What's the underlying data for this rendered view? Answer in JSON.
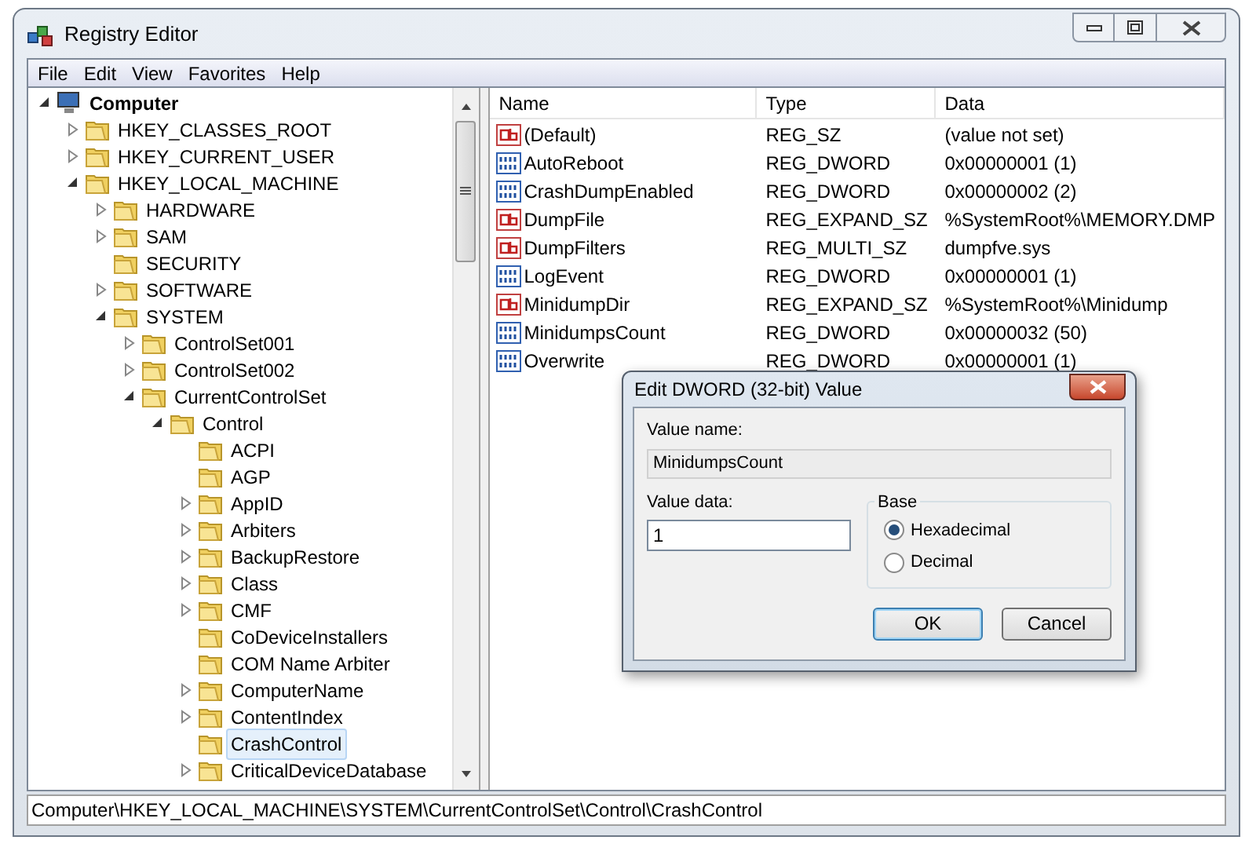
{
  "window": {
    "title": "Registry Editor"
  },
  "menu": [
    "File",
    "Edit",
    "View",
    "Favorites",
    "Help"
  ],
  "tree": [
    {
      "label": "Computer",
      "kind": "computer",
      "expanded": true,
      "selected": false,
      "children": [
        {
          "label": "HKEY_CLASSES_ROOT",
          "kind": "branch",
          "expanded": false,
          "selected": false
        },
        {
          "label": "HKEY_CURRENT_USER",
          "kind": "branch",
          "expanded": false,
          "selected": false
        },
        {
          "label": "HKEY_LOCAL_MACHINE",
          "kind": "branch",
          "expanded": true,
          "selected": false,
          "children": [
            {
              "label": "HARDWARE",
              "kind": "branch",
              "expanded": false,
              "selected": false
            },
            {
              "label": "SAM",
              "kind": "branch",
              "expanded": false,
              "selected": false
            },
            {
              "label": "SECURITY",
              "kind": "leaf",
              "selected": false
            },
            {
              "label": "SOFTWARE",
              "kind": "branch",
              "expanded": false,
              "selected": false
            },
            {
              "label": "SYSTEM",
              "kind": "branch",
              "expanded": true,
              "selected": false,
              "children": [
                {
                  "label": "ControlSet001",
                  "kind": "branch",
                  "expanded": false,
                  "selected": false
                },
                {
                  "label": "ControlSet002",
                  "kind": "branch",
                  "expanded": false,
                  "selected": false
                },
                {
                  "label": "CurrentControlSet",
                  "kind": "branch",
                  "expanded": true,
                  "selected": false,
                  "children": [
                    {
                      "label": "Control",
                      "kind": "branch",
                      "expanded": true,
                      "selected": false,
                      "children": [
                        {
                          "label": "ACPI",
                          "kind": "leaf",
                          "selected": false
                        },
                        {
                          "label": "AGP",
                          "kind": "leaf",
                          "selected": false
                        },
                        {
                          "label": "AppID",
                          "kind": "branch",
                          "expanded": false,
                          "selected": false
                        },
                        {
                          "label": "Arbiters",
                          "kind": "branch",
                          "expanded": false,
                          "selected": false
                        },
                        {
                          "label": "BackupRestore",
                          "kind": "branch",
                          "expanded": false,
                          "selected": false
                        },
                        {
                          "label": "Class",
                          "kind": "branch",
                          "expanded": false,
                          "selected": false
                        },
                        {
                          "label": "CMF",
                          "kind": "branch",
                          "expanded": false,
                          "selected": false
                        },
                        {
                          "label": "CoDeviceInstallers",
                          "kind": "leaf",
                          "selected": false
                        },
                        {
                          "label": "COM Name Arbiter",
                          "kind": "leaf",
                          "selected": false
                        },
                        {
                          "label": "ComputerName",
                          "kind": "branch",
                          "expanded": false,
                          "selected": false
                        },
                        {
                          "label": "ContentIndex",
                          "kind": "branch",
                          "expanded": false,
                          "selected": false
                        },
                        {
                          "label": "CrashControl",
                          "kind": "leaf",
                          "selected": true
                        },
                        {
                          "label": "CriticalDeviceDatabase",
                          "kind": "branch",
                          "expanded": false,
                          "selected": false
                        }
                      ]
                    }
                  ]
                }
              ]
            }
          ]
        }
      ]
    }
  ],
  "values": {
    "columns": [
      "Name",
      "Type",
      "Data"
    ],
    "rows": [
      {
        "kind": "string",
        "name": "(Default)",
        "type": "REG_SZ",
        "data": "(value not set)"
      },
      {
        "kind": "binary",
        "name": "AutoReboot",
        "type": "REG_DWORD",
        "data": "0x00000001 (1)"
      },
      {
        "kind": "binary",
        "name": "CrashDumpEnabled",
        "type": "REG_DWORD",
        "data": "0x00000002 (2)"
      },
      {
        "kind": "string",
        "name": "DumpFile",
        "type": "REG_EXPAND_SZ",
        "data": "%SystemRoot%\\MEMORY.DMP"
      },
      {
        "kind": "string",
        "name": "DumpFilters",
        "type": "REG_MULTI_SZ",
        "data": "dumpfve.sys"
      },
      {
        "kind": "binary",
        "name": "LogEvent",
        "type": "REG_DWORD",
        "data": "0x00000001 (1)"
      },
      {
        "kind": "string",
        "name": "MinidumpDir",
        "type": "REG_EXPAND_SZ",
        "data": "%SystemRoot%\\Minidump"
      },
      {
        "kind": "binary",
        "name": "MinidumpsCount",
        "type": "REG_DWORD",
        "data": "0x00000032 (50)"
      },
      {
        "kind": "binary",
        "name": "Overwrite",
        "type": "REG_DWORD",
        "data": "0x00000001 (1)"
      }
    ]
  },
  "status_bar": "Computer\\HKEY_LOCAL_MACHINE\\SYSTEM\\CurrentControlSet\\Control\\CrashControl",
  "dialog": {
    "title": "Edit DWORD (32-bit) Value",
    "value_name_label": "Value name:",
    "value_name": "MinidumpsCount",
    "value_data_label": "Value data:",
    "value_data": "1",
    "base_label": "Base",
    "base_options": [
      {
        "label": "Hexadecimal",
        "selected": true
      },
      {
        "label": "Decimal",
        "selected": false
      }
    ],
    "buttons": [
      {
        "label": "OK",
        "kind": "default"
      },
      {
        "label": "Cancel",
        "kind": "normal"
      }
    ]
  }
}
